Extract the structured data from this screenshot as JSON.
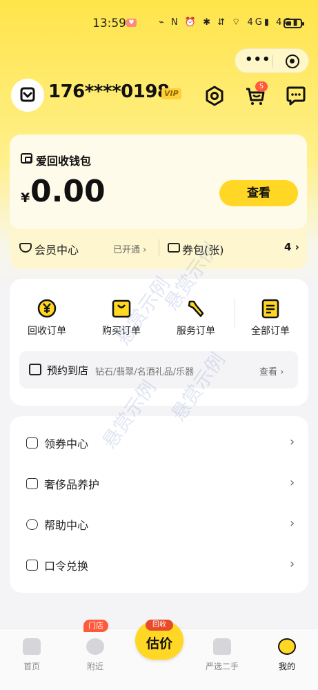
{
  "status_bar": {
    "time": "13:59",
    "icons_text": "⌁ N ⏰ ✱ ⇵ ⌔ 4G▮ 4G▮"
  },
  "header": {
    "phone": "176****0198",
    "vip": "VIP",
    "cart_badge": "5"
  },
  "wallet": {
    "title": "爱回收钱包",
    "currency": "¥",
    "amount": "0.00",
    "view_label": "查看",
    "member_label": "会员中心",
    "member_status": "已开通",
    "coupon_label": "券包(张)",
    "coupon_count": "4"
  },
  "orders": {
    "items": [
      {
        "label": "回收订单"
      },
      {
        "label": "购买订单"
      },
      {
        "label": "服务订单"
      },
      {
        "label": "全部订单"
      }
    ],
    "appointment": {
      "label": "预约到店",
      "desc": "钻石/翡翠/名酒礼品/乐器",
      "view_label": "查看"
    }
  },
  "menu": {
    "items": [
      {
        "label": "领券中心"
      },
      {
        "label": "奢侈品养护"
      },
      {
        "label": "帮助中心"
      },
      {
        "label": "口令兑换"
      }
    ]
  },
  "tabbar": {
    "home": "首页",
    "nearby": "附近",
    "store_badge": "门店",
    "center_tag": "回收",
    "center_label": "估价",
    "second_hand": "严选二手",
    "mine": "我的"
  },
  "watermark": "悬赏示例",
  "colors": {
    "accent": "#ffd724",
    "badge": "#ff5a3a",
    "background": "#f4f4f6"
  }
}
